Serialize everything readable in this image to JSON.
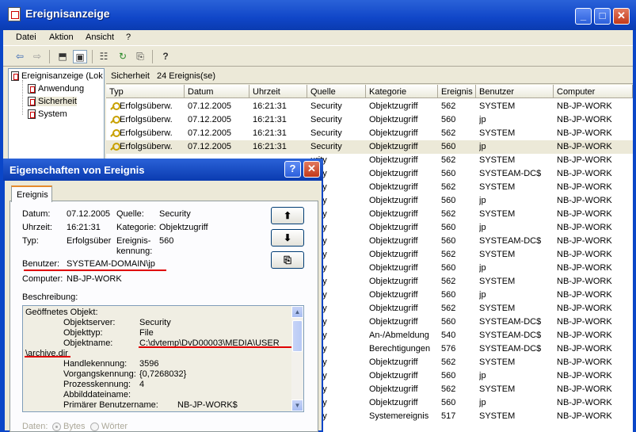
{
  "window": {
    "title": "Ereignisanzeige",
    "minimize": "_",
    "maximize": "□",
    "close": "✕"
  },
  "menu": [
    "Datei",
    "Aktion",
    "Ansicht",
    "?"
  ],
  "toolbar": {
    "back": "⇦",
    "forward": "⇨",
    "up": "⬒",
    "showhide": "▣",
    "props": "☷",
    "refresh": "↻",
    "export": "⎘",
    "help": "?"
  },
  "tree": {
    "root": "Ereignisanzeige (Lok",
    "items": [
      "Anwendung",
      "Sicherheit",
      "System"
    ]
  },
  "list": {
    "header_name": "Sicherheit",
    "header_count": "24 Ereignis(se)",
    "columns": [
      "Typ",
      "Datum",
      "Uhrzeit",
      "Quelle",
      "Kategorie",
      "Ereignis",
      "Benutzer",
      "Computer"
    ],
    "rows": [
      [
        "Erfolgsüberw.",
        "07.12.2005",
        "16:21:31",
        "Security",
        "Objektzugriff",
        "562",
        "SYSTEM",
        "NB-JP-WORK"
      ],
      [
        "Erfolgsüberw.",
        "07.12.2005",
        "16:21:31",
        "Security",
        "Objektzugriff",
        "560",
        "jp",
        "NB-JP-WORK"
      ],
      [
        "Erfolgsüberw.",
        "07.12.2005",
        "16:21:31",
        "Security",
        "Objektzugriff",
        "562",
        "SYSTEM",
        "NB-JP-WORK"
      ],
      [
        "Erfolgsüberw.",
        "07.12.2005",
        "16:21:31",
        "Security",
        "Objektzugriff",
        "560",
        "jp",
        "NB-JP-WORK"
      ],
      [
        "",
        "",
        "",
        "urity",
        "Objektzugriff",
        "562",
        "SYSTEM",
        "NB-JP-WORK"
      ],
      [
        "",
        "",
        "",
        "urity",
        "Objektzugriff",
        "560",
        "SYSTEAM-DC$",
        "NB-JP-WORK"
      ],
      [
        "",
        "",
        "",
        "urity",
        "Objektzugriff",
        "562",
        "SYSTEM",
        "NB-JP-WORK"
      ],
      [
        "",
        "",
        "",
        "urity",
        "Objektzugriff",
        "560",
        "jp",
        "NB-JP-WORK"
      ],
      [
        "",
        "",
        "",
        "urity",
        "Objektzugriff",
        "562",
        "SYSTEM",
        "NB-JP-WORK"
      ],
      [
        "",
        "",
        "",
        "urity",
        "Objektzugriff",
        "560",
        "jp",
        "NB-JP-WORK"
      ],
      [
        "",
        "",
        "",
        "urity",
        "Objektzugriff",
        "560",
        "SYSTEAM-DC$",
        "NB-JP-WORK"
      ],
      [
        "",
        "",
        "",
        "urity",
        "Objektzugriff",
        "562",
        "SYSTEM",
        "NB-JP-WORK"
      ],
      [
        "",
        "",
        "",
        "urity",
        "Objektzugriff",
        "560",
        "jp",
        "NB-JP-WORK"
      ],
      [
        "",
        "",
        "",
        "urity",
        "Objektzugriff",
        "562",
        "SYSTEM",
        "NB-JP-WORK"
      ],
      [
        "",
        "",
        "",
        "urity",
        "Objektzugriff",
        "560",
        "jp",
        "NB-JP-WORK"
      ],
      [
        "",
        "",
        "",
        "urity",
        "Objektzugriff",
        "562",
        "SYSTEM",
        "NB-JP-WORK"
      ],
      [
        "",
        "",
        "",
        "urity",
        "Objektzugriff",
        "560",
        "SYSTEAM-DC$",
        "NB-JP-WORK"
      ],
      [
        "",
        "",
        "",
        "urity",
        "An-/Abmeldung",
        "540",
        "SYSTEAM-DC$",
        "NB-JP-WORK"
      ],
      [
        "",
        "",
        "",
        "urity",
        "Berechtigungen",
        "576",
        "SYSTEAM-DC$",
        "NB-JP-WORK"
      ],
      [
        "",
        "",
        "",
        "urity",
        "Objektzugriff",
        "562",
        "SYSTEM",
        "NB-JP-WORK"
      ],
      [
        "",
        "",
        "",
        "urity",
        "Objektzugriff",
        "560",
        "jp",
        "NB-JP-WORK"
      ],
      [
        "",
        "",
        "",
        "urity",
        "Objektzugriff",
        "562",
        "SYSTEM",
        "NB-JP-WORK"
      ],
      [
        "",
        "",
        "",
        "urity",
        "Objektzugriff",
        "560",
        "jp",
        "NB-JP-WORK"
      ],
      [
        "",
        "",
        "",
        "urity",
        "Systemereignis",
        "517",
        "SYSTEM",
        "NB-JP-WORK"
      ]
    ]
  },
  "dialog": {
    "title": "Eigenschaften von Ereignis",
    "help": "?",
    "close": "✕",
    "tab": "Ereignis",
    "datum_label": "Datum:",
    "datum": "07.12.2005",
    "quelle_label": "Quelle:",
    "quelle": "Security",
    "uhrzeit_label": "Uhrzeit:",
    "uhrzeit": "16:21:31",
    "kategorie_label": "Kategorie:",
    "kategorie": "Objektzugriff",
    "typ_label": "Typ:",
    "typ": "Erfolgsüber",
    "kennung_label_1": "Ereignis-",
    "kennung_label_2": "kennung:",
    "kennung": "560",
    "benutzer_label": "Benutzer:",
    "benutzer": "SYSTEAM-DOMAIN\\jp",
    "computer_label": "Computer:",
    "computer": "NB-JP-WORK",
    "beschreibung_label": "Beschreibung:",
    "up": "⬆",
    "down": "⬇",
    "copy": "⎘",
    "desc": {
      "line0": "Geöffnetes Objekt:",
      "objektserver_label": "Objektserver:",
      "objektserver": "Security",
      "objekttyp_label": "Objekttyp:",
      "objekttyp": "File",
      "objektname_label": "Objektname:",
      "objektname": "C:\\dvtemp\\DvD00003\\MEDIA\\USER",
      "archive": "\\archive.dir",
      "handle_label": "Handlekennung:",
      "handle": "3596",
      "vorgang_label": "Vorgangskennung:",
      "vorgang": "{0,7268032}",
      "prozess_label": "Prozesskennung:",
      "prozess": "4",
      "abbild_label": "Abbilddateiname:",
      "primaer_label": "Primärer Benutzername:",
      "primaer": "NB-JP-WORK$"
    },
    "daten_label": "Daten:",
    "bytes": "Bytes",
    "woerter": "Wörter"
  }
}
